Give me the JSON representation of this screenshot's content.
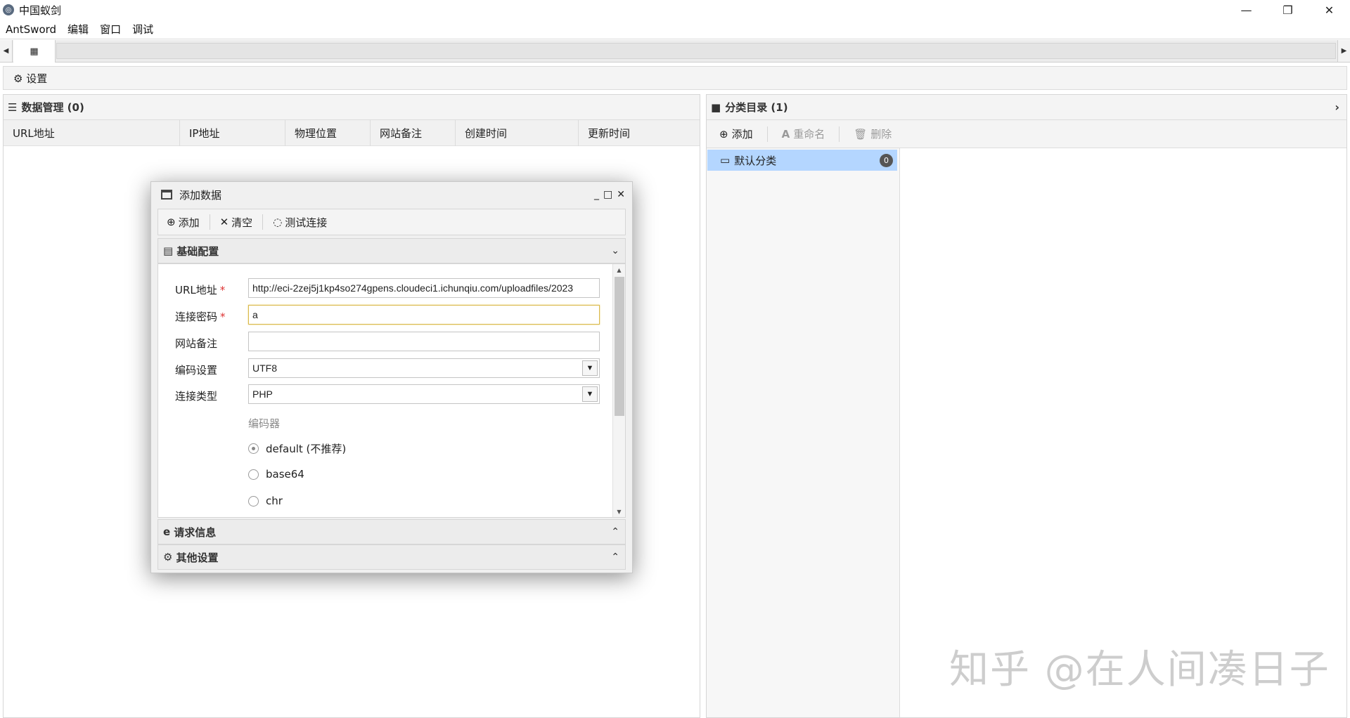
{
  "window": {
    "title": "中国蚁剑",
    "icon": "antsword-logo-icon",
    "controls": [
      "minimize-icon",
      "restore-icon",
      "close-icon"
    ]
  },
  "menu": [
    "AntSword",
    "编辑",
    "窗口",
    "调试"
  ],
  "settings_label": "设置",
  "data_panel": {
    "title": "数据管理 (0)",
    "columns": [
      "URL地址",
      "IP地址",
      "物理位置",
      "网站备注",
      "创建时间",
      "更新时间"
    ]
  },
  "category_panel": {
    "title": "分类目录 (1)",
    "toolbar": {
      "add": "添加",
      "rename": "重命名",
      "delete": "删除"
    },
    "items": [
      {
        "label": "默认分类",
        "count": "0"
      }
    ]
  },
  "dialog": {
    "title": "添加数据",
    "toolbar": {
      "add": "添加",
      "clear": "清空",
      "test": "测试连接"
    },
    "sections": {
      "basic": "基础配置",
      "request": "请求信息",
      "other": "其他设置"
    },
    "form": {
      "url_label": "URL地址",
      "url_value": "http://eci-2zej5j1kp4so274gpens.cloudeci1.ichunqiu.com/uploadfiles/2023",
      "password_label": "连接密码",
      "password_value": "a",
      "note_label": "网站备注",
      "note_value": "",
      "encoding_label": "编码设置",
      "encoding_value": "UTF8",
      "type_label": "连接类型",
      "type_value": "PHP",
      "encoder_label": "编码器",
      "required_mark": "*",
      "encoders": [
        {
          "label": "default (不推荐)",
          "checked": true
        },
        {
          "label": "base64",
          "checked": false
        },
        {
          "label": "chr",
          "checked": false
        }
      ]
    }
  },
  "watermark": "知乎 @在人间凑日子"
}
